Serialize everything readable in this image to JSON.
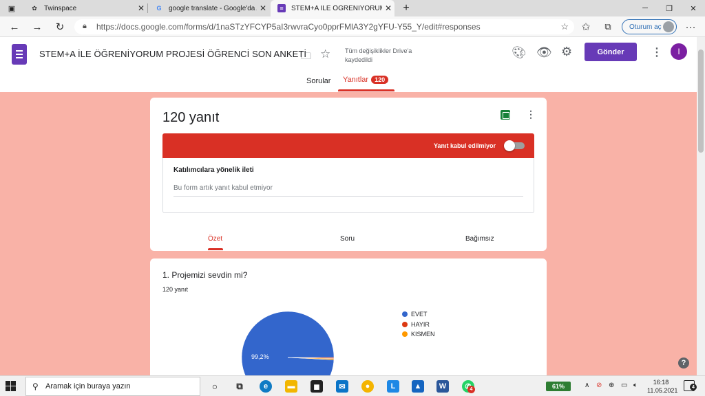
{
  "browser": {
    "tabs": [
      {
        "title": "Twinspace",
        "icon": "twinspace-icon"
      },
      {
        "title": "google translate - Google'da Ara",
        "icon": "google-icon"
      },
      {
        "title": "STEM+A İLE ÖĞRENİYORUM PRO",
        "icon": "forms-icon"
      }
    ],
    "url": "https://docs.google.com/forms/d/1naSTzYFCYP5aI3rwvraCyo0pprFMlA3Y2gYFU-Y55_Y/edit#responses",
    "signin_label": "Oturum aç"
  },
  "form": {
    "title": "STEM+A İLE ÖĞRENİYORUM PROJESİ ÖĞRENCİ SON ANKETİ",
    "saved_status": "Tüm değişiklikler Drive'a kaydedildi",
    "send_label": "Gönder",
    "user_initial": "I",
    "tabs": {
      "questions": "Sorular",
      "responses": "Yanıtlar",
      "responses_count": "120"
    }
  },
  "responses": {
    "count_label": "120 yanıt",
    "not_accepting_label": "Yanıt kabul edilmiyor",
    "accepting": false,
    "message_heading": "Katılımcılara yönelik ileti",
    "message_text": "Bu form artık yanıt kabul etmiyor",
    "subtabs": {
      "summary": "Özet",
      "question": "Soru",
      "individual": "Bağımsız"
    }
  },
  "question1": {
    "title": "1. Projemizi sevdin mi?",
    "response_count": "120 yanıt"
  },
  "chart_data": {
    "type": "pie",
    "title": "",
    "categories": [
      "EVET",
      "HAYIR",
      "KISMEN"
    ],
    "values": [
      99.2,
      0.4,
      0.4
    ],
    "colors": [
      "#3366cc",
      "#dc3912",
      "#ff9900"
    ],
    "data_labels": [
      "99,2%",
      "",
      ""
    ],
    "legend_position": "right"
  },
  "taskbar": {
    "search_placeholder": "Aramak için buraya yazın",
    "battery": "61%",
    "time": "16:18",
    "date": "11.05.2021",
    "whatsapp_badge": "4",
    "notification_count": "4"
  }
}
